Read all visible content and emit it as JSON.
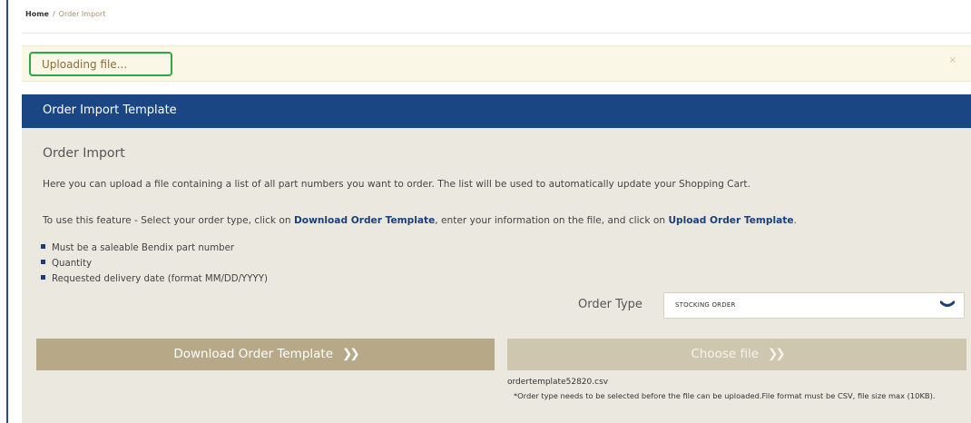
{
  "breadcrumb": {
    "home": "Home",
    "separator": "/",
    "current": "Order Import"
  },
  "alert": {
    "message": "Uploading file...",
    "close_glyph": "×"
  },
  "panel": {
    "title": "Order Import Template"
  },
  "section": {
    "title": "Order Import",
    "description": "Here you can upload a file containing a list of all part numbers you want to order. The list will be used to automatically update your Shopping Cart.",
    "instructions_prefix": "To use this feature - Select your order type, click on ",
    "download_link": "Download Order Template",
    "instructions_middle": ", enter your information on the file, and click on ",
    "upload_link": "Upload Order Template",
    "instructions_suffix": "."
  },
  "requirements": [
    "Must be a saleable Bendix part number",
    "Quantity",
    "Requested delivery date (format MM/DD/YYYY)"
  ],
  "order_type": {
    "label": "Order Type",
    "selected": "STOCKING ORDER",
    "icon": "chevron-down-icon"
  },
  "buttons": {
    "download": "Download Order Template",
    "choose": "Choose file",
    "arrow_glyph": "❯❯"
  },
  "file": {
    "name": "ordertemplate52820.csv",
    "note": "*Order type needs to be selected before the file can be uploaded.File format must be CSV, file size max (10KB)."
  },
  "colors": {
    "header_bg": "#1a4784",
    "panel_bg": "#ebe8df",
    "alert_bg": "#fbf7e6",
    "highlight_border": "#2aa84a",
    "download_btn": "#b7a988",
    "choose_btn": "#cfc6af",
    "link": "#1a3f7a"
  }
}
